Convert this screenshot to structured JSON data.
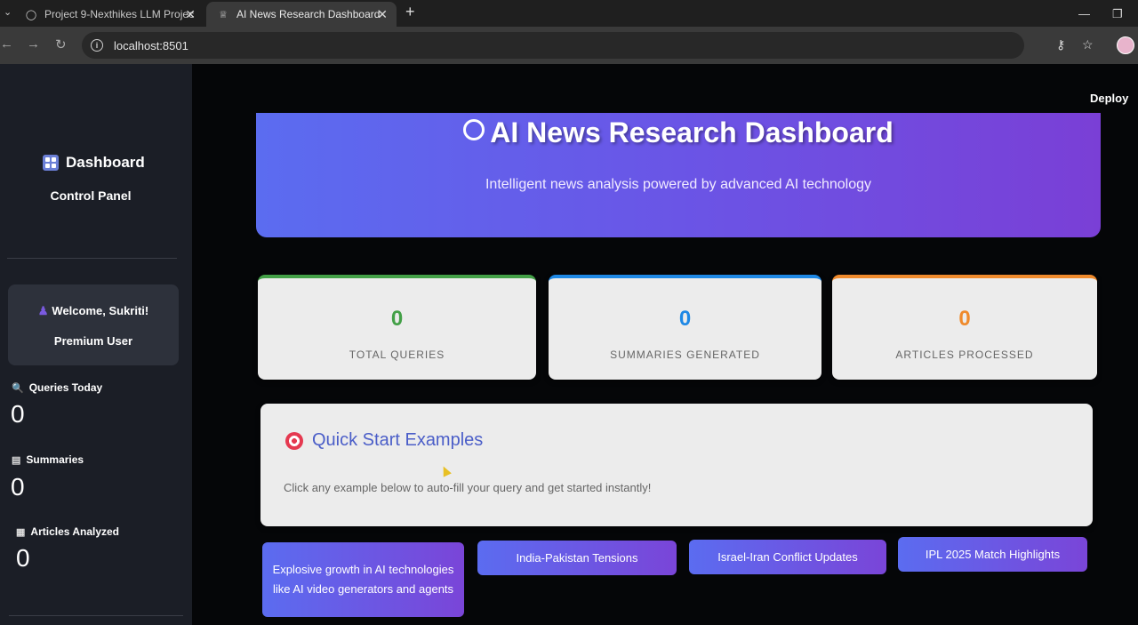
{
  "browser": {
    "tabs": [
      {
        "title": "Project 9-Nexthikes LLM Projec",
        "active": false
      },
      {
        "title": "AI News Research Dashboard",
        "active": true
      }
    ],
    "url": "localhost:8501"
  },
  "app": {
    "deploy_label": "Deploy",
    "sidebar": {
      "title": "Dashboard",
      "subtitle": "Control Panel",
      "welcome": "Welcome, Sukriti!",
      "user_tier": "Premium User",
      "metrics": [
        {
          "label": "Queries Today",
          "value": "0",
          "icon": "magnifier-icon"
        },
        {
          "label": "Summaries",
          "value": "0",
          "icon": "document-icon"
        },
        {
          "label": "Articles Analyzed",
          "value": "0",
          "icon": "newspaper-icon"
        }
      ]
    },
    "hero": {
      "title": "AI News Research Dashboard",
      "subtitle": "Intelligent news analysis powered by advanced AI technology"
    },
    "stats": [
      {
        "value": "0",
        "label": "TOTAL QUERIES",
        "color": "#43a047"
      },
      {
        "value": "0",
        "label": "SUMMARIES GENERATED",
        "color": "#1e88e5"
      },
      {
        "value": "0",
        "label": "ARTICLES PROCESSED",
        "color": "#ef8a2c"
      }
    ],
    "quick_start": {
      "title": "Quick Start Examples",
      "description": "Click any example below to auto-fill your query and get started instantly!"
    },
    "examples": [
      "Explosive growth in AI technologies like AI video generators and agents",
      "India-Pakistan Tensions",
      "Israel-Iran Conflict Updates",
      "IPL 2025 Match Highlights"
    ]
  }
}
